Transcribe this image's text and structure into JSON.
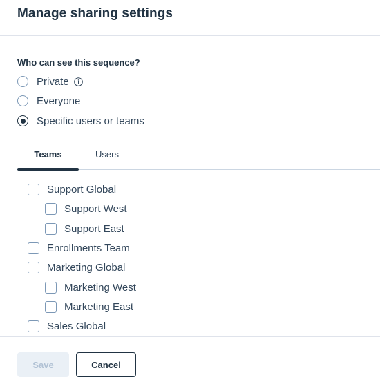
{
  "modal": {
    "title": "Manage sharing settings"
  },
  "visibility": {
    "question": "Who can see this sequence?",
    "options": [
      {
        "label": "Private",
        "selected": false,
        "info_icon": "info-circle-icon"
      },
      {
        "label": "Everyone",
        "selected": false
      },
      {
        "label": "Specific users or teams",
        "selected": true
      }
    ]
  },
  "tabs": [
    {
      "label": "Teams",
      "active": true
    },
    {
      "label": "Users",
      "active": false
    }
  ],
  "teams": [
    {
      "label": "Support Global",
      "checked": false,
      "level": 0
    },
    {
      "label": "Support West",
      "checked": false,
      "level": 1
    },
    {
      "label": "Support East",
      "checked": false,
      "level": 1
    },
    {
      "label": "Enrollments Team",
      "checked": false,
      "level": 0
    },
    {
      "label": "Marketing Global",
      "checked": false,
      "level": 0
    },
    {
      "label": "Marketing West",
      "checked": false,
      "level": 1
    },
    {
      "label": "Marketing East",
      "checked": false,
      "level": 1
    },
    {
      "label": "Sales Global",
      "checked": false,
      "level": 0
    }
  ],
  "footer": {
    "save_label": "Save",
    "save_disabled": true,
    "cancel_label": "Cancel"
  },
  "colors": {
    "primary_text": "#213343",
    "body_text": "#33475b",
    "border": "#7c98b6",
    "divider": "#dfe3eb",
    "disabled_bg": "#eaf0f6",
    "disabled_text": "#b0c1d4"
  }
}
